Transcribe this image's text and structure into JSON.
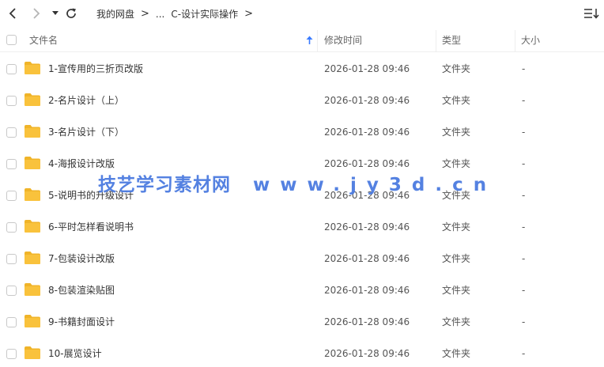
{
  "toolbar": {
    "back_icon": "chevron-left-icon",
    "forward_icon": "chevron-right-icon",
    "dropdown_icon": "caret-down-icon",
    "refresh_icon": "refresh-icon",
    "view_icon": "sort-list-icon"
  },
  "breadcrumb": {
    "root": "我的网盘",
    "ellipsis": "...",
    "current": "C-设计实际操作",
    "separator": ">"
  },
  "columns": {
    "name": "文件名",
    "modified": "修改时间",
    "type": "类型",
    "size": "大小",
    "sort_icon": "sort-up-arrow-icon"
  },
  "files": [
    {
      "name": "1-宣传用的三折页改版",
      "modified": "2026-01-28 09:46",
      "type": "文件夹",
      "size": "-"
    },
    {
      "name": "2-名片设计（上）",
      "modified": "2026-01-28 09:46",
      "type": "文件夹",
      "size": "-"
    },
    {
      "name": "3-名片设计（下）",
      "modified": "2026-01-28 09:46",
      "type": "文件夹",
      "size": "-"
    },
    {
      "name": "4-海报设计改版",
      "modified": "2026-01-28 09:46",
      "type": "文件夹",
      "size": "-"
    },
    {
      "name": "5-说明书的升级设计",
      "modified": "2026-01-28 09:46",
      "type": "文件夹",
      "size": "-"
    },
    {
      "name": "6-平时怎样看说明书",
      "modified": "2026-01-28 09:46",
      "type": "文件夹",
      "size": "-"
    },
    {
      "name": "7-包装设计改版",
      "modified": "2026-01-28 09:46",
      "type": "文件夹",
      "size": "-"
    },
    {
      "name": "8-包装渲染贴图",
      "modified": "2026-01-28 09:46",
      "type": "文件夹",
      "size": "-"
    },
    {
      "name": "9-书籍封面设计",
      "modified": "2026-01-28 09:46",
      "type": "文件夹",
      "size": "-"
    },
    {
      "name": "10-展览设计",
      "modified": "2026-01-28 09:46",
      "type": "文件夹",
      "size": "-"
    }
  ],
  "watermark": {
    "part1": "技艺学习素材网",
    "part2": "www.jy3d.cn"
  },
  "colors": {
    "folder": "#f9c23c",
    "folder_dark": "#f0b429",
    "sort_arrow": "#3a7bff",
    "watermark": "#4b7be0"
  }
}
